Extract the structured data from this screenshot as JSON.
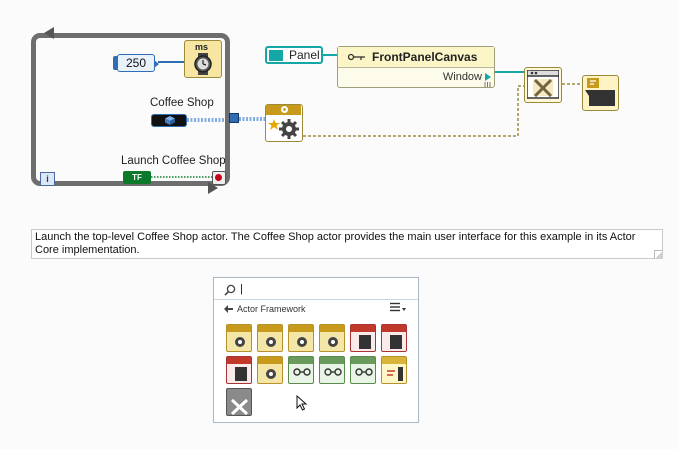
{
  "block_diagram": {
    "while_loop": {
      "wait_ms_label": "ms",
      "constant_250": "250",
      "coffee_shop_label": "Coffee Shop",
      "launch_label": "Launch Coffee Shop",
      "tf_label": "TF",
      "info_label": "i"
    },
    "panel_constant": "Panel",
    "front_panel_canvas": {
      "title": "FrontPanelCanvas",
      "property": "Window"
    }
  },
  "comment": {
    "text": "Launch the top-level Coffee Shop actor.  The Coffee Shop actor provides the main user interface for this example in its Actor Core implementation."
  },
  "palette": {
    "search_value": "|",
    "breadcrumb": "Actor Framework",
    "tiles": [
      {
        "row": 0,
        "col": 0,
        "style": "t-gold",
        "icon": "launch-actor-icon"
      },
      {
        "row": 0,
        "col": 1,
        "style": "t-gold",
        "icon": "launch-nested-actor-icon"
      },
      {
        "row": 0,
        "col": 2,
        "style": "t-gold",
        "icon": "actor-view-icon"
      },
      {
        "row": 0,
        "col": 3,
        "style": "t-gold",
        "icon": "actor-glasses-icon"
      },
      {
        "row": 0,
        "col": 4,
        "style": "t-red",
        "icon": "message-panel-icon"
      },
      {
        "row": 0,
        "col": 5,
        "style": "t-red",
        "icon": "message-alert-icon"
      },
      {
        "row": 1,
        "col": 0,
        "style": "t-red",
        "icon": "message-stop-icon"
      },
      {
        "row": 1,
        "col": 1,
        "style": "t-gold",
        "icon": "actor-settings-icon"
      },
      {
        "row": 1,
        "col": 2,
        "style": "t-green",
        "icon": "message-glasses-icon"
      },
      {
        "row": 1,
        "col": 3,
        "style": "t-green",
        "icon": "message-route-icon"
      },
      {
        "row": 1,
        "col": 4,
        "style": "t-green",
        "icon": "message-view-icon"
      },
      {
        "row": 1,
        "col": 5,
        "style": "t-yellow",
        "icon": "message-error-icon"
      },
      {
        "row": 2,
        "col": 0,
        "style": "t-gray",
        "icon": "tools-icon"
      }
    ]
  },
  "colors": {
    "loop_border": "#6e6e6e",
    "numeric_blue": "#2f6db5",
    "teal": "#15a7a7",
    "boolean_green": "#0d7a2b",
    "refnum_olive": "#9a8a3a"
  }
}
